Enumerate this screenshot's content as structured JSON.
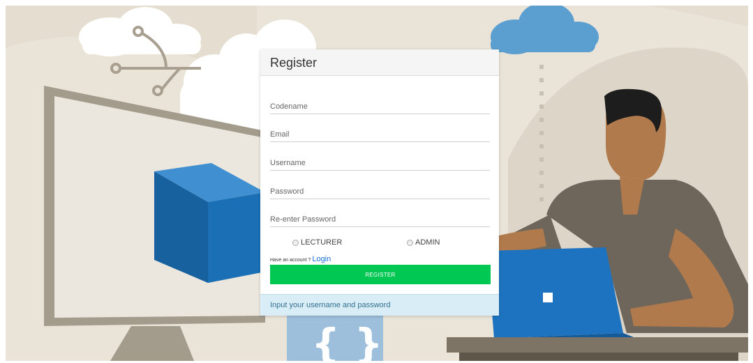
{
  "register": {
    "title": "Register",
    "fields": {
      "codename_placeholder": "Codename",
      "email_placeholder": "Email",
      "username_placeholder": "Username",
      "password_placeholder": "Password",
      "reenter_password_placeholder": "Re-enter Password"
    },
    "roles": [
      "LECTURER",
      "ADMIN"
    ],
    "have_account_text": "Have an account ?",
    "login_link": "Login",
    "register_button": "REGISTER",
    "footer_message": "Input your username and password"
  },
  "colors": {
    "register_button": "#00c853",
    "login_link": "#1a6fd8",
    "footer_background": "#d9edf7",
    "cube": "#1b6fb5",
    "cloud_blue": "#5b9fd0"
  }
}
